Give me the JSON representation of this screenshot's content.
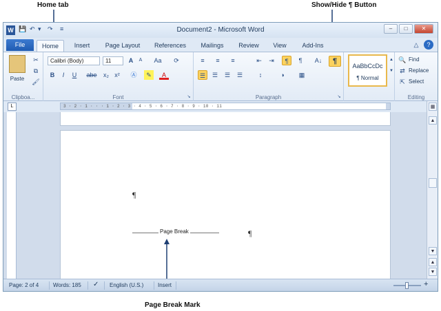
{
  "annotations": {
    "home_tab": "Home tab",
    "show_hide_button": "Show/Hide ¶ Button",
    "page_break_mark": "Page Break Mark"
  },
  "titlebar": {
    "title": "Document2 - Microsoft Word",
    "app_icon": "W"
  },
  "tabs": {
    "file": "File",
    "home": "Home",
    "insert": "Insert",
    "page_layout": "Page Layout",
    "references": "References",
    "mailings": "Mailings",
    "review": "Review",
    "view": "View",
    "add_ins": "Add-Ins"
  },
  "ribbon": {
    "clipboard": {
      "label": "Clipboa...",
      "paste": "Paste"
    },
    "font": {
      "label": "Font",
      "font_name": "Calibri (Body)",
      "font_size": "11",
      "bold": "B",
      "italic": "I",
      "underline": "U",
      "strikethrough": "abe",
      "subscript": "x₂",
      "superscript": "x²",
      "grow": "A",
      "shrink": "A",
      "change_case": "Aa",
      "font_color": "A"
    },
    "paragraph": {
      "label": "Paragraph",
      "show_hide": "¶",
      "sort": "A↓"
    },
    "styles": {
      "sample": "AaBbCcDc",
      "name": "¶ Normal"
    },
    "editing": {
      "label": "Editing",
      "find": "Find",
      "replace": "Replace",
      "select": "Select"
    }
  },
  "ruler_text": "3 · 2 · 1 · · · 1 · 2 · 3 · 4 · 5 · 6 · 7 · 8 · 9 · 10 · 11",
  "document": {
    "pilcrow": "¶",
    "page_break_label": "Page Break"
  },
  "status": {
    "page": "Page: 2 of 4",
    "words": "Words: 185",
    "language": "English (U.S.)",
    "mode": "Insert"
  },
  "colors": {
    "accent": "#1f5bb2",
    "highlight": "#fbd25f",
    "ribbon_bg": "#e2ebf6"
  }
}
